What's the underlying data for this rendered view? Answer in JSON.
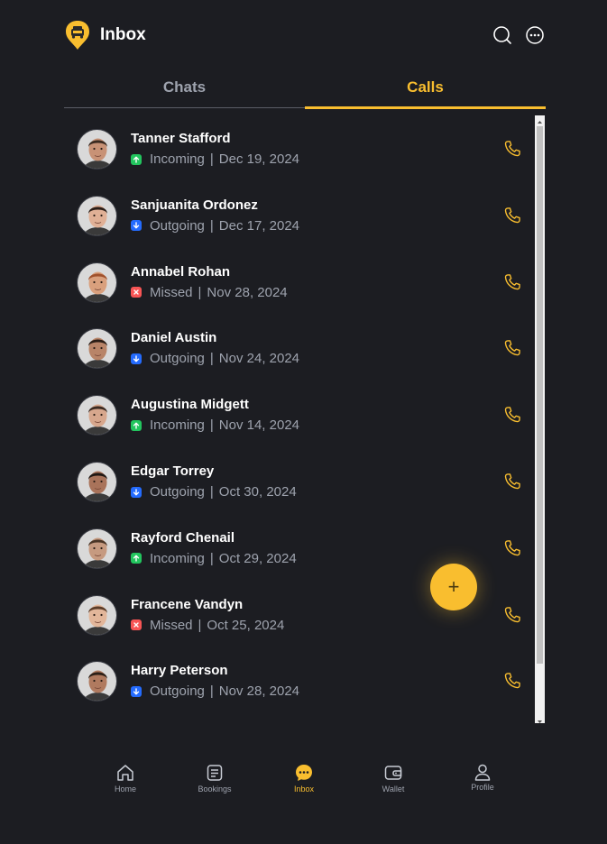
{
  "header": {
    "title": "Inbox",
    "logo_icon": "taxi-logo-icon",
    "search_icon": "search-icon",
    "more_icon": "more-icon"
  },
  "tabs": [
    {
      "label": "Chats",
      "active": false
    },
    {
      "label": "Calls",
      "active": true
    }
  ],
  "colors": {
    "accent": "#f9be2f",
    "background": "#1c1d22",
    "muted_text": "#9ea3ae",
    "incoming": "#22c55e",
    "outgoing": "#246bfd",
    "missed": "#f75555"
  },
  "calls": [
    {
      "name": "Tanner Stafford",
      "type": "Incoming",
      "date": "Dec 19, 2024"
    },
    {
      "name": "Sanjuanita Ordonez",
      "type": "Outgoing",
      "date": "Dec 17, 2024"
    },
    {
      "name": "Annabel Rohan",
      "type": "Missed",
      "date": "Nov 28, 2024"
    },
    {
      "name": "Daniel Austin",
      "type": "Outgoing",
      "date": "Nov 24, 2024"
    },
    {
      "name": "Augustina Midgett",
      "type": "Incoming",
      "date": "Nov 14, 2024"
    },
    {
      "name": "Edgar Torrey",
      "type": "Outgoing",
      "date": "Oct 30, 2024"
    },
    {
      "name": "Rayford Chenail",
      "type": "Incoming",
      "date": "Oct 29, 2024"
    },
    {
      "name": "Francene Vandyn",
      "type": "Missed",
      "date": "Oct 25, 2024"
    },
    {
      "name": "Harry Peterson",
      "type": "Outgoing",
      "date": "Nov 28, 2024"
    }
  ],
  "fab": {
    "label": "+",
    "icon": "plus-icon"
  },
  "bottom_nav": [
    {
      "label": "Home",
      "icon": "home-icon",
      "active": false
    },
    {
      "label": "Bookings",
      "icon": "bookings-icon",
      "active": false
    },
    {
      "label": "Inbox",
      "icon": "chat-icon",
      "active": true
    },
    {
      "label": "Wallet",
      "icon": "wallet-icon",
      "active": false
    },
    {
      "label": "Profile",
      "icon": "profile-icon",
      "active": false
    }
  ]
}
